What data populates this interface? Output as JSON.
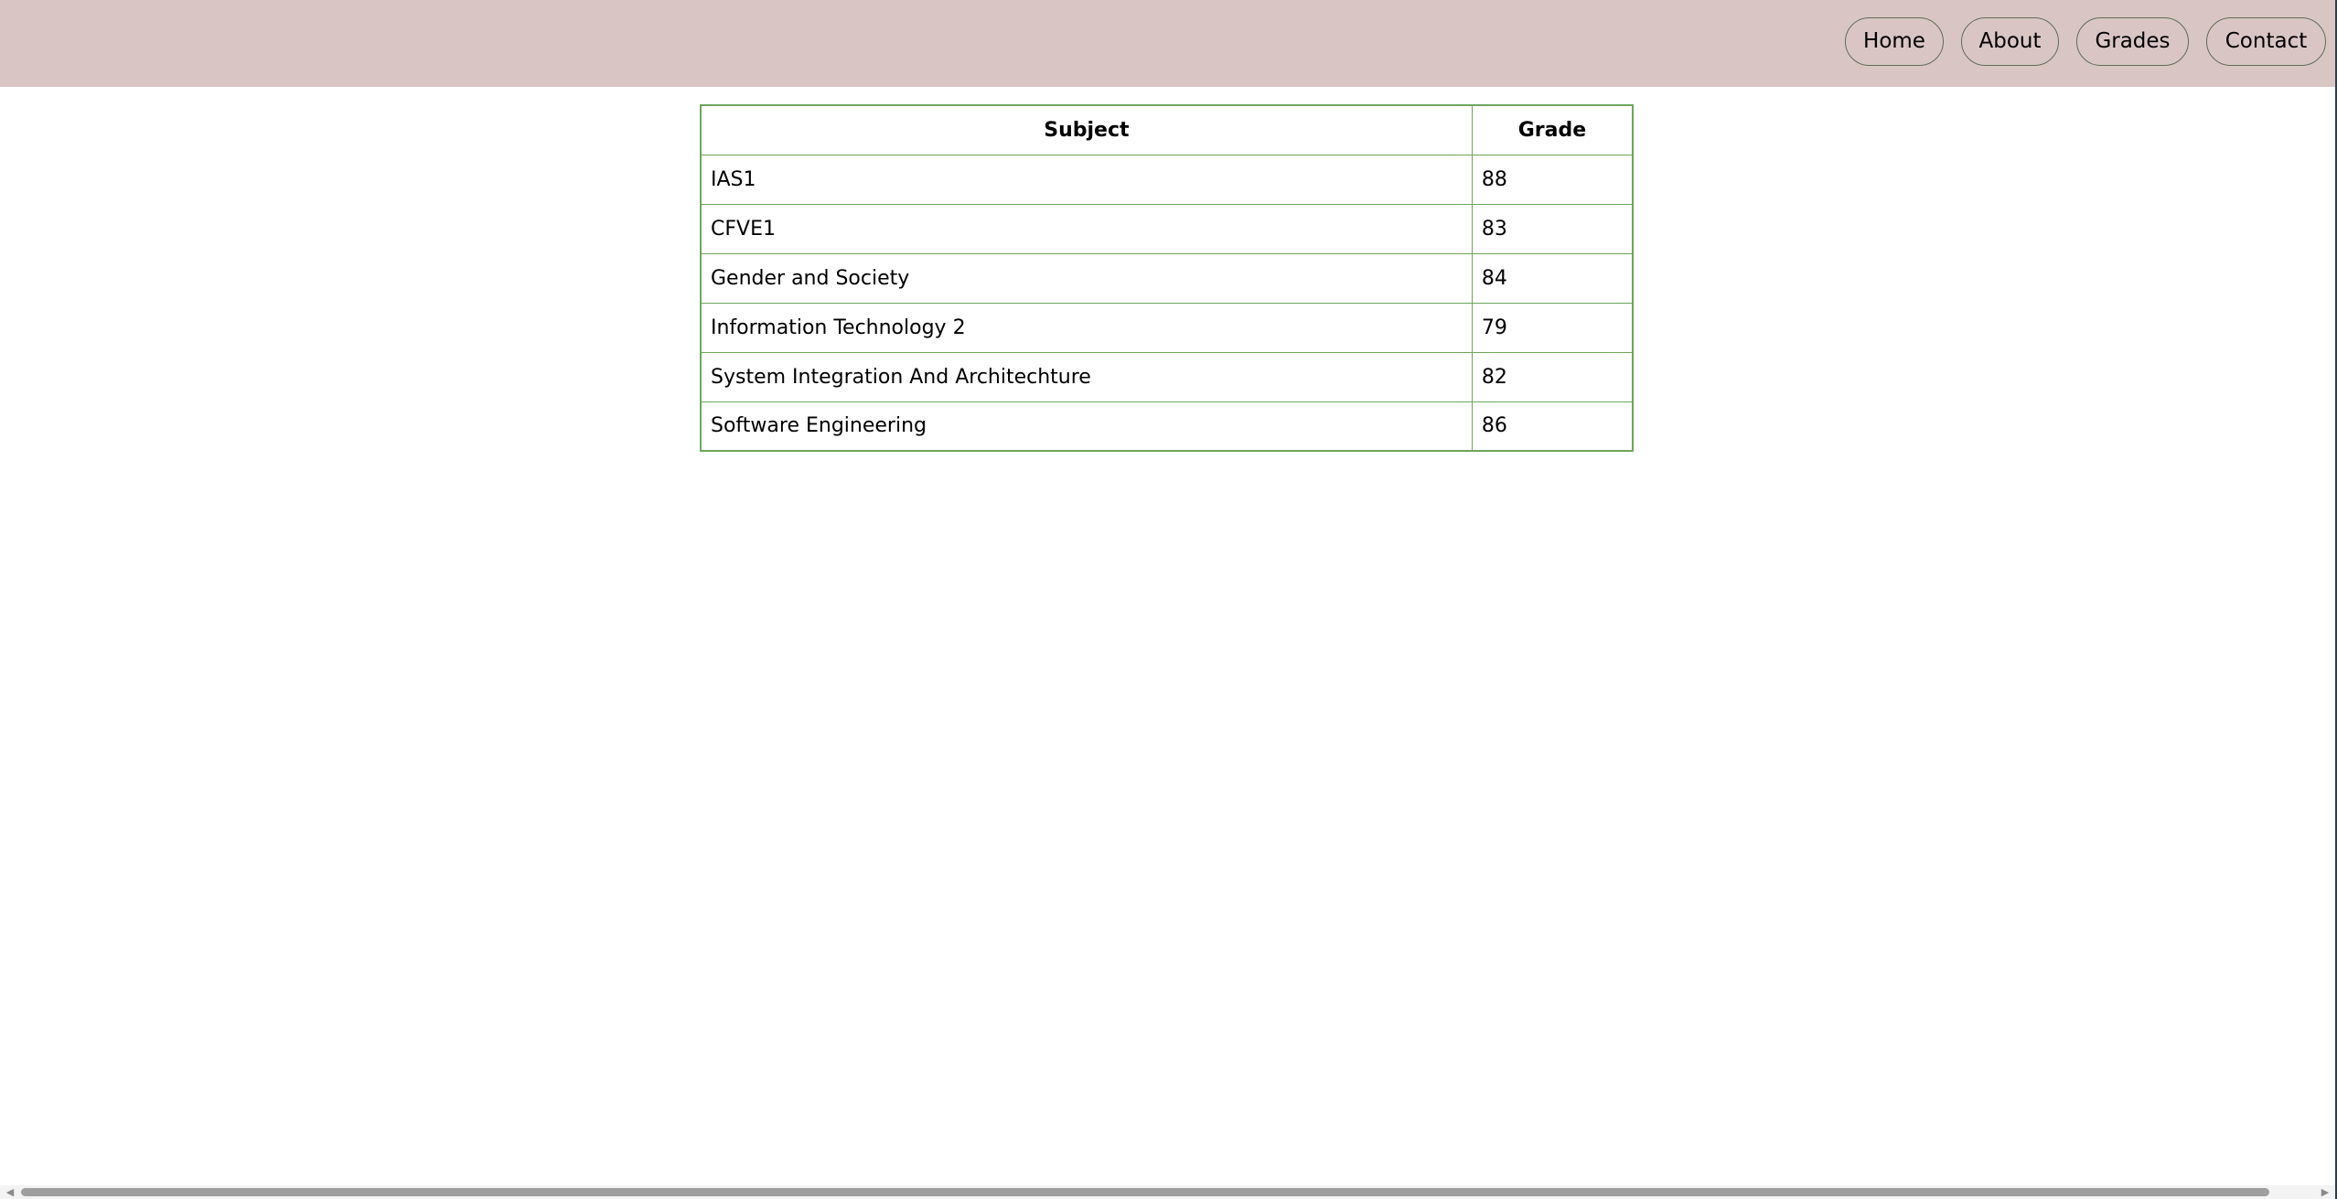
{
  "nav": {
    "links": [
      {
        "label": "Home"
      },
      {
        "label": "About"
      },
      {
        "label": "Grades"
      },
      {
        "label": "Contact"
      }
    ]
  },
  "table": {
    "headers": {
      "subject": "Subject",
      "grade": "Grade"
    },
    "rows": [
      {
        "subject": "IAS1",
        "grade": "88"
      },
      {
        "subject": "CFVE1",
        "grade": "83"
      },
      {
        "subject": "Gender and Society",
        "grade": "84"
      },
      {
        "subject": "Information Technology 2",
        "grade": "79"
      },
      {
        "subject": "System Integration And Architechture",
        "grade": "82"
      },
      {
        "subject": "Software Engineering",
        "grade": "86"
      }
    ]
  },
  "scrollbar": {
    "left_icon": "arrow-left-icon",
    "right_icon": "arrow-right-icon"
  },
  "colors": {
    "navbar_background": "#d9c6c4",
    "table_border": "#6ea55e",
    "nav_border": "#5f6d57"
  }
}
